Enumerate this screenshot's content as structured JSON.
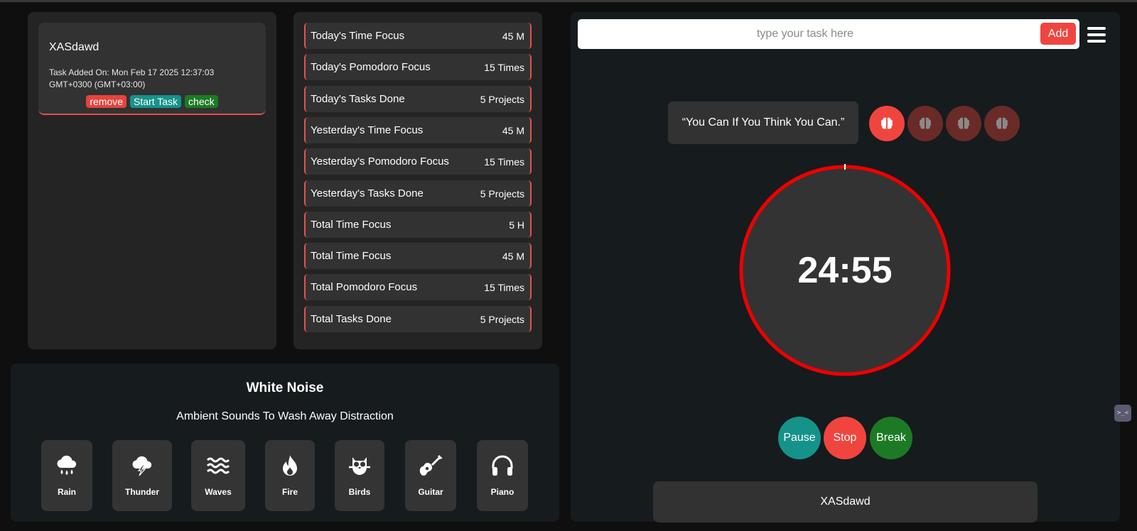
{
  "task_panel": {
    "task": {
      "name": "XASdawd",
      "date": "Task Added On: Mon Feb 17 2025 12:37:03 GMT+0300 (GMT+03:00)",
      "actions": {
        "remove": "remove",
        "start": "Start Task",
        "check": "check"
      }
    }
  },
  "stats": [
    {
      "label": "Today's Time Focus",
      "value": "45 M"
    },
    {
      "label": "Today's Pomodoro Focus",
      "value": "15 Times"
    },
    {
      "label": "Today's Tasks Done",
      "value": "5 Projects"
    },
    {
      "label": "Yesterday's Time Focus",
      "value": "45 M"
    },
    {
      "label": "Yesterday's Pomodoro Focus",
      "value": "15 Times"
    },
    {
      "label": "Yesterday's Tasks Done",
      "value": "5 Projects"
    },
    {
      "label": "Total Time Focus",
      "value": "5 H"
    },
    {
      "label": "Total Time Focus",
      "value": "45 M"
    },
    {
      "label": "Total Pomodoro Focus",
      "value": "15 Times"
    },
    {
      "label": "Total Tasks Done",
      "value": "5 Projects"
    }
  ],
  "white_noise": {
    "title": "White Noise",
    "subtitle": "Ambient Sounds To Wash Away Distraction",
    "sounds": [
      {
        "label": "Rain",
        "icon": "rain-icon"
      },
      {
        "label": "Thunder",
        "icon": "thunder-icon"
      },
      {
        "label": "Waves",
        "icon": "waves-icon"
      },
      {
        "label": "Fire",
        "icon": "fire-icon"
      },
      {
        "label": "Birds",
        "icon": "owl-icon"
      },
      {
        "label": "Guitar",
        "icon": "guitar-icon"
      },
      {
        "label": "Piano",
        "icon": "headphones-icon"
      }
    ]
  },
  "timer": {
    "input_placeholder": "type your task here",
    "add_label": "Add",
    "quote": "“You Can If You Think You Can.”",
    "time": "24:55",
    "pomodoros_total": 4,
    "pomodoros_active": 1,
    "controls": {
      "pause": "Pause",
      "stop": "Stop",
      "break": "Break"
    },
    "current_task": "XASdawd"
  },
  "side_widget": ">_<",
  "colors": {
    "accent_red": "#f0453f",
    "teal": "#15938a",
    "green": "#1d7a24",
    "ring_red": "#ee0000"
  }
}
